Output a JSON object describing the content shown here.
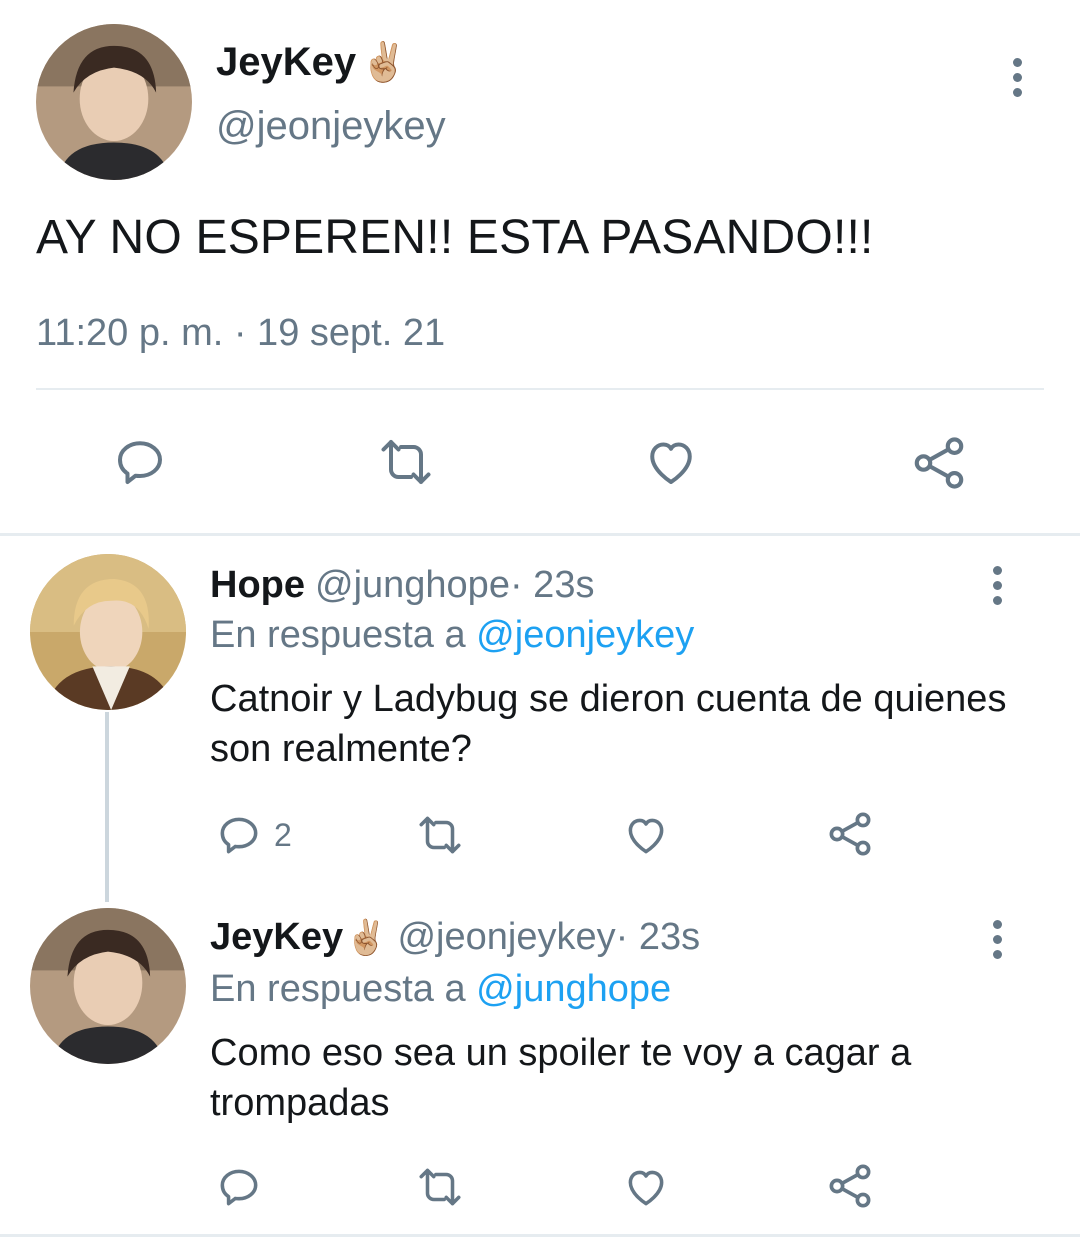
{
  "main_tweet": {
    "name": "JeyKey",
    "name_emoji": "✌🏼",
    "handle": "@jeonjeykey",
    "text": "AY NO ESPEREN!! ESTA PASANDO!!!",
    "timestamp": "11:20 p. m. · 19 sept. 21",
    "actions": [
      "reply-icon",
      "retweet-icon",
      "like-icon",
      "share-icon"
    ]
  },
  "replies": [
    {
      "name": "Hope",
      "name_emoji": "",
      "handle": "@junghope",
      "time": " · 23s",
      "reply_prefix": "En respuesta a ",
      "reply_to": "@jeonjeykey",
      "text": "Catnoir y Ladybug se dieron cuenta de quienes son realmente?",
      "reply_count": "2"
    },
    {
      "name": "JeyKey",
      "name_emoji": "✌🏼",
      "handle": "@jeonjeykey",
      "time": " · 23s",
      "reply_prefix": "En respuesta a ",
      "reply_to": "@junghope",
      "text": "Como eso sea un spoiler te voy a cagar a trompadas",
      "reply_count": ""
    }
  ],
  "colors": {
    "text_primary": "#14171a",
    "text_secondary": "#657786",
    "link": "#1da1f2",
    "divider": "#e6ecf0",
    "thread_line": "#ccd6dd"
  }
}
